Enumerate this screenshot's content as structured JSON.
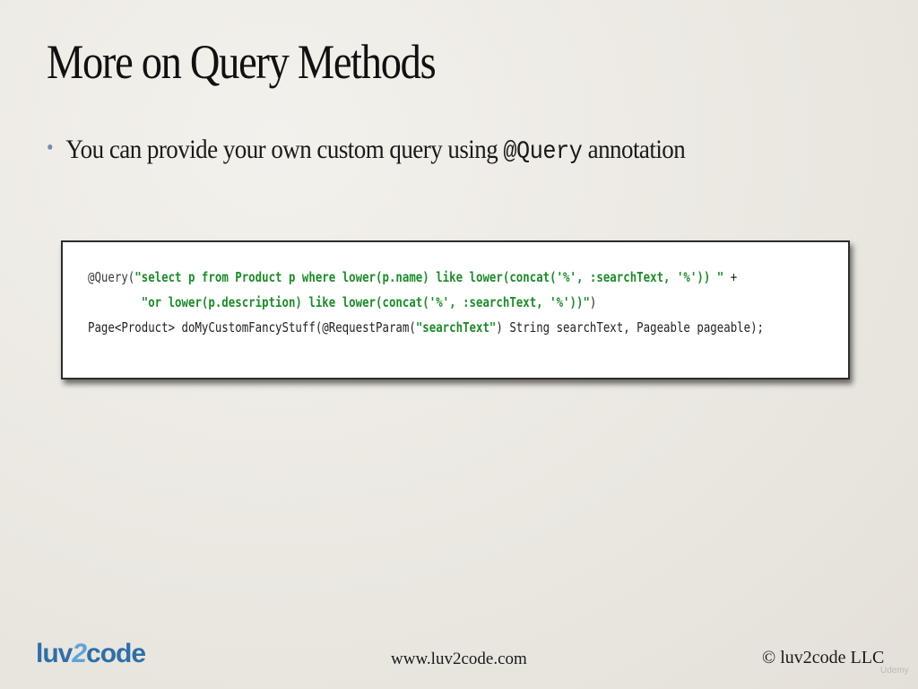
{
  "slide": {
    "title": "More on Query Methods",
    "bullet": {
      "text_before": "You can provide your own custom query using ",
      "code": "@Query",
      "text_after": " annotation"
    }
  },
  "code_box": {
    "line1": {
      "annotation": "@Query(",
      "string": "\"select p from Product p where lower(p.name) like lower(concat('%', :searchText, '%')) \"",
      "rest": " +"
    },
    "line2": {
      "indent": "        ",
      "string": "\"or lower(p.description) like lower(concat('%', :searchText, '%'))\"",
      "rest": ")"
    },
    "line3": {
      "before": "Page<Product> doMyCustomFancyStuff(@RequestParam(",
      "string": "\"searchText\"",
      "after": ") String searchText, Pageable pageable);"
    }
  },
  "footer": {
    "logo_left": "luv",
    "logo_two": "2",
    "logo_right": "code",
    "url": "www.luv2code.com",
    "copyright": "© luv2code LLC",
    "watermark": "Udemy"
  }
}
